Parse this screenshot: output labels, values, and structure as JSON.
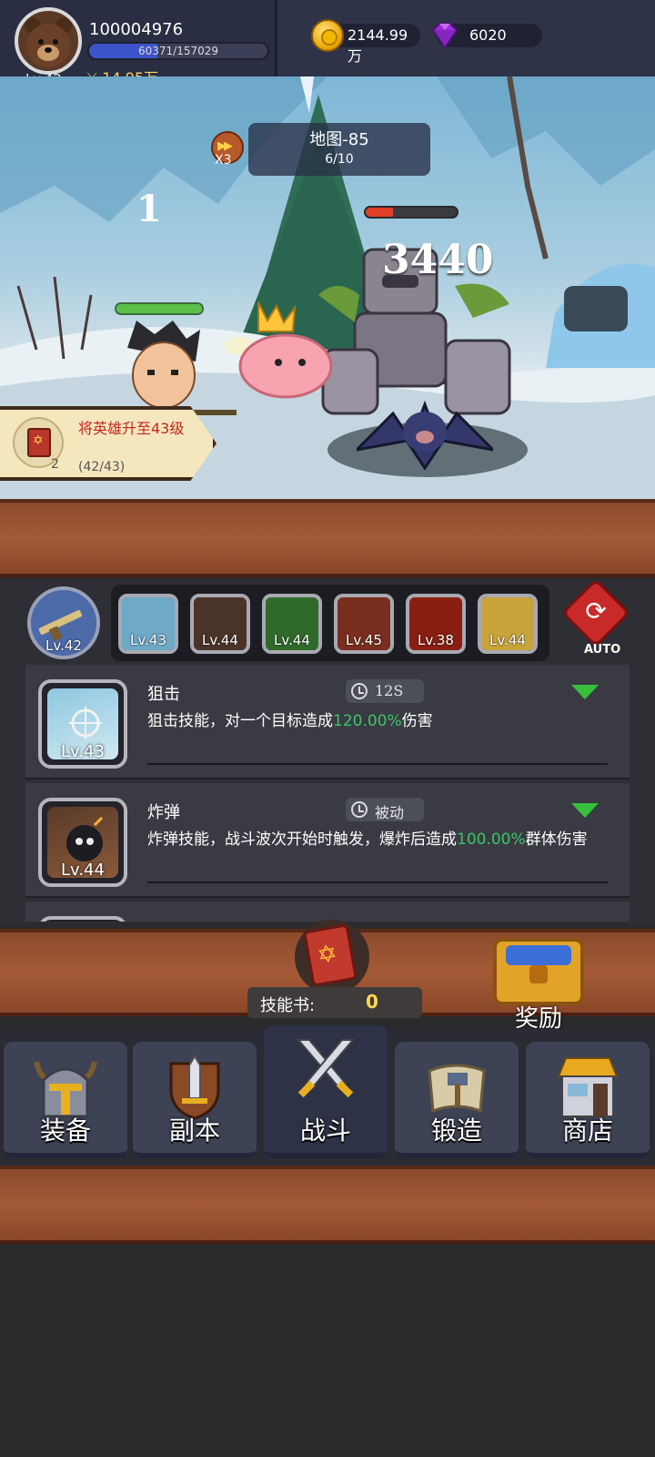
{
  "player": {
    "id": "100004976",
    "level": "Lv.42",
    "xp_text": "60371/157029",
    "xp_progress": 0.384,
    "power": "14.95万",
    "avatar_icon": "bear-avatar-icon"
  },
  "currency": {
    "gold": "2144.99万",
    "gems": "6020",
    "gold_icon": "gold-coin-icon",
    "gem_icon": "purple-gem-icon"
  },
  "battle": {
    "speed": "X3",
    "map_title": "地图-85",
    "wave": "6/10",
    "combo": "1",
    "damage": "3440",
    "hero_hp": 1.0,
    "enemy_hp": 0.3,
    "enemy2_hp": 0.6
  },
  "quest": {
    "text": "将英雄升至43级",
    "progress": "(42/43)",
    "count": "2",
    "icon": "skill-book-icon"
  },
  "weapon": {
    "level": "Lv.42",
    "icon": "rifle-icon"
  },
  "skill_slots": [
    {
      "level": "Lv.43",
      "icon": "sniper-skill-icon",
      "color": "#6ea9c8"
    },
    {
      "level": "Lv.44",
      "icon": "bomb-skill-icon",
      "color": "#4a3428"
    },
    {
      "level": "Lv.44",
      "icon": "poison-skill-icon",
      "color": "#2f6a2a"
    },
    {
      "level": "Lv.45",
      "icon": "fire-beast-skill-icon",
      "color": "#7a2e1e"
    },
    {
      "level": "Lv.38",
      "icon": "meteor-skill-icon",
      "color": "#8a1e10"
    },
    {
      "level": "Lv.44",
      "icon": "lightning-skill-icon",
      "color": "#c9a43a"
    }
  ],
  "auto_label": "AUTO",
  "skills": [
    {
      "name": "狙击",
      "cooldown": "12S",
      "level": "Lv.43",
      "desc_prefix": "狙击技能，对一个目标造成",
      "desc_value": "120.00%",
      "desc_suffix": "伤害",
      "icon": "sniper-skill-icon"
    },
    {
      "name": "炸弹",
      "cooldown": "被动",
      "level": "Lv.44",
      "desc_prefix": "炸弹技能，战斗波次开始时触发，爆炸后造成",
      "desc_value": "100.00%",
      "desc_suffix": "群体伤害",
      "icon": "bomb-skill-icon"
    }
  ],
  "skillbook": {
    "label": "技能书:",
    "count": "0"
  },
  "reward_label": "奖励",
  "nav": [
    {
      "label": "装备",
      "icon": "helmet-icon"
    },
    {
      "label": "副本",
      "icon": "sword-shield-icon"
    },
    {
      "label": "战斗",
      "icon": "crossed-swords-icon",
      "active": true
    },
    {
      "label": "锻造",
      "icon": "hammer-scroll-icon"
    },
    {
      "label": "商店",
      "icon": "shop-icon"
    }
  ]
}
